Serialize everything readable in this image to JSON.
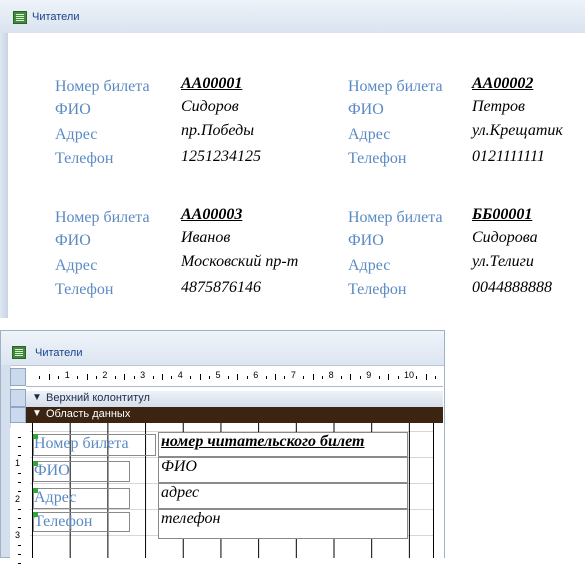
{
  "report_window": {
    "title": "Читатели",
    "field_labels": {
      "ticket": "Номер билета",
      "name": "ФИО",
      "address": "Адрес",
      "phone": "Телефон"
    },
    "records": [
      {
        "ticket": "АА00001",
        "name": "Сидоров",
        "address": "пр.Победы",
        "phone": "1251234125"
      },
      {
        "ticket": "АА00002",
        "name": "Петров",
        "address": "ул.Крещатик",
        "phone": "0121111111"
      },
      {
        "ticket": "АА00003",
        "name": "Иванов",
        "address": "Московский пр-т",
        "phone": "4875876146"
      },
      {
        "ticket": "ББ00001",
        "name": "Сидорова",
        "address": "ул.Телиги",
        "phone": "0044888888"
      }
    ]
  },
  "design_window": {
    "title": "Читатели",
    "ruler_numbers": [
      "1",
      "2",
      "3",
      "4",
      "5",
      "6",
      "7",
      "8",
      "9",
      "10"
    ],
    "vruler_numbers": [
      "1",
      "2",
      "3"
    ],
    "header_band": "Верхний колонтитул",
    "data_band": "Область данных",
    "label_controls": [
      "Номер билета",
      "ФИО",
      "Адрес",
      "Телефон"
    ],
    "field_controls": [
      "номер читательского билет",
      "ФИО",
      "адрес",
      "телефон"
    ],
    "band_arrow_icon": "band-arrow-icon",
    "app_icon": "report-icon"
  }
}
